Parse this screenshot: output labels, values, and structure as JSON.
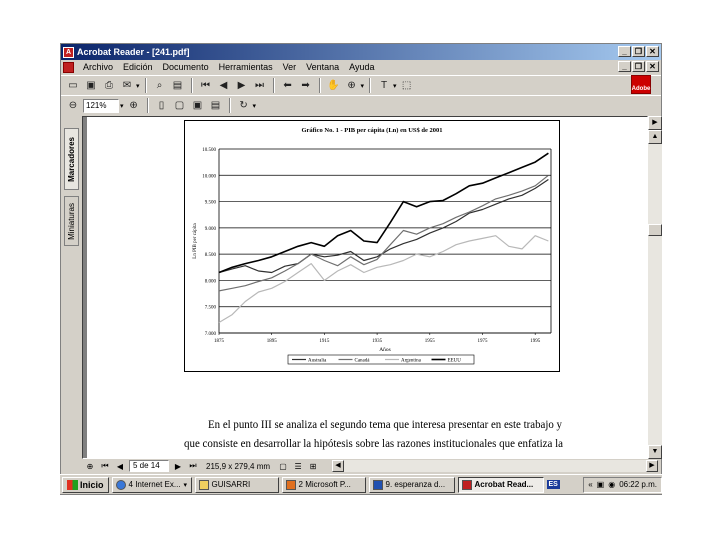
{
  "window": {
    "title": "Acrobat Reader - [241.pdf]",
    "caption_buttons": [
      "_",
      "❐",
      "✕"
    ]
  },
  "menubar": {
    "items": [
      "Archivo",
      "Edición",
      "Documento",
      "Herramientas",
      "Ver",
      "Ventana",
      "Ayuda"
    ]
  },
  "toolbar": {
    "zoom": "121%",
    "adobe_label": "Adobe"
  },
  "side_tabs": {
    "bookmarks": "Marcadores",
    "thumbnails": "Miniaturas"
  },
  "status": {
    "page": "5 de 14",
    "size": "215,9 x 279,4 mm"
  },
  "document": {
    "text_lines": [
      "En el punto III se analiza el segundo tema que interesa presentar en este trabajo y",
      "que consiste en desarrollar la hipótesis sobre las razones institucionales que enfatiza la"
    ]
  },
  "chart_data": {
    "type": "line",
    "title": "Gráfico No. 1 - PIB per cápita (Ln) en US$ de 2001",
    "xlabel": "Años",
    "ylabel": "Ln PIB per cápita",
    "xlim": [
      1875,
      2001
    ],
    "ylim": [
      7.0,
      10.5
    ],
    "yticks": [
      "7.000",
      "7.500",
      "8.000",
      "8.500",
      "9.000",
      "9.500",
      "10.000",
      "10.500"
    ],
    "xticks": [
      "1875",
      "1895",
      "1915",
      "1935",
      "1955",
      "1975",
      "1995"
    ],
    "grid": "horizontal",
    "legend_position": "bottom",
    "series": [
      {
        "name": "Australia",
        "color": "#303030",
        "width": 1.2,
        "x": [
          1875,
          1880,
          1885,
          1890,
          1895,
          1900,
          1905,
          1910,
          1915,
          1920,
          1925,
          1930,
          1935,
          1940,
          1945,
          1950,
          1955,
          1960,
          1965,
          1970,
          1975,
          1980,
          1985,
          1990,
          1995,
          2000
        ],
        "y": [
          8.15,
          8.22,
          8.28,
          8.18,
          8.15,
          8.27,
          8.32,
          8.5,
          8.45,
          8.48,
          8.55,
          8.38,
          8.45,
          8.6,
          8.7,
          8.78,
          8.9,
          9.0,
          9.12,
          9.28,
          9.35,
          9.45,
          9.55,
          9.62,
          9.75,
          9.92
        ]
      },
      {
        "name": "Canadá",
        "color": "#707070",
        "width": 1.2,
        "x": [
          1875,
          1880,
          1885,
          1890,
          1895,
          1900,
          1905,
          1910,
          1915,
          1920,
          1925,
          1930,
          1935,
          1940,
          1945,
          1950,
          1955,
          1960,
          1965,
          1970,
          1975,
          1980,
          1985,
          1990,
          1995,
          2000
        ],
        "y": [
          7.8,
          7.85,
          7.9,
          7.98,
          8.05,
          8.18,
          8.32,
          8.5,
          8.38,
          8.28,
          8.45,
          8.3,
          8.4,
          8.68,
          8.95,
          8.88,
          9.0,
          9.08,
          9.2,
          9.3,
          9.42,
          9.55,
          9.62,
          9.7,
          9.8,
          10.0
        ]
      },
      {
        "name": "Argentina",
        "color": "#b8b8b8",
        "width": 1.2,
        "x": [
          1875,
          1880,
          1885,
          1890,
          1895,
          1900,
          1905,
          1910,
          1915,
          1920,
          1925,
          1930,
          1935,
          1940,
          1945,
          1950,
          1955,
          1960,
          1965,
          1970,
          1975,
          1980,
          1985,
          1990,
          1995,
          2000
        ],
        "y": [
          7.2,
          7.35,
          7.6,
          7.78,
          7.85,
          7.98,
          8.15,
          8.32,
          8.0,
          8.18,
          8.3,
          8.15,
          8.25,
          8.3,
          8.38,
          8.5,
          8.45,
          8.55,
          8.68,
          8.75,
          8.8,
          8.85,
          8.65,
          8.6,
          8.85,
          8.75
        ]
      },
      {
        "name": "EEUU",
        "color": "#000000",
        "width": 1.6,
        "x": [
          1875,
          1880,
          1885,
          1890,
          1895,
          1900,
          1905,
          1910,
          1915,
          1920,
          1925,
          1930,
          1935,
          1940,
          1945,
          1950,
          1955,
          1960,
          1965,
          1970,
          1975,
          1980,
          1985,
          1990,
          1995,
          2000
        ],
        "y": [
          8.15,
          8.25,
          8.32,
          8.38,
          8.45,
          8.55,
          8.65,
          8.72,
          8.65,
          8.85,
          8.95,
          8.75,
          8.72,
          9.1,
          9.5,
          9.4,
          9.5,
          9.52,
          9.65,
          9.8,
          9.85,
          9.95,
          10.05,
          10.15,
          10.25,
          10.42
        ]
      }
    ]
  },
  "taskbar": {
    "start": "Inicio",
    "items": [
      {
        "label": "4 Internet Ex...",
        "active": false
      },
      {
        "label": "GUISARRI",
        "active": false
      },
      {
        "label": "2 Microsoft P...",
        "active": false
      },
      {
        "label": "9. esperanza d...",
        "active": false
      },
      {
        "label": "Acrobat Read...",
        "active": true
      }
    ],
    "language": "ES",
    "clock": "06:22 p.m."
  }
}
